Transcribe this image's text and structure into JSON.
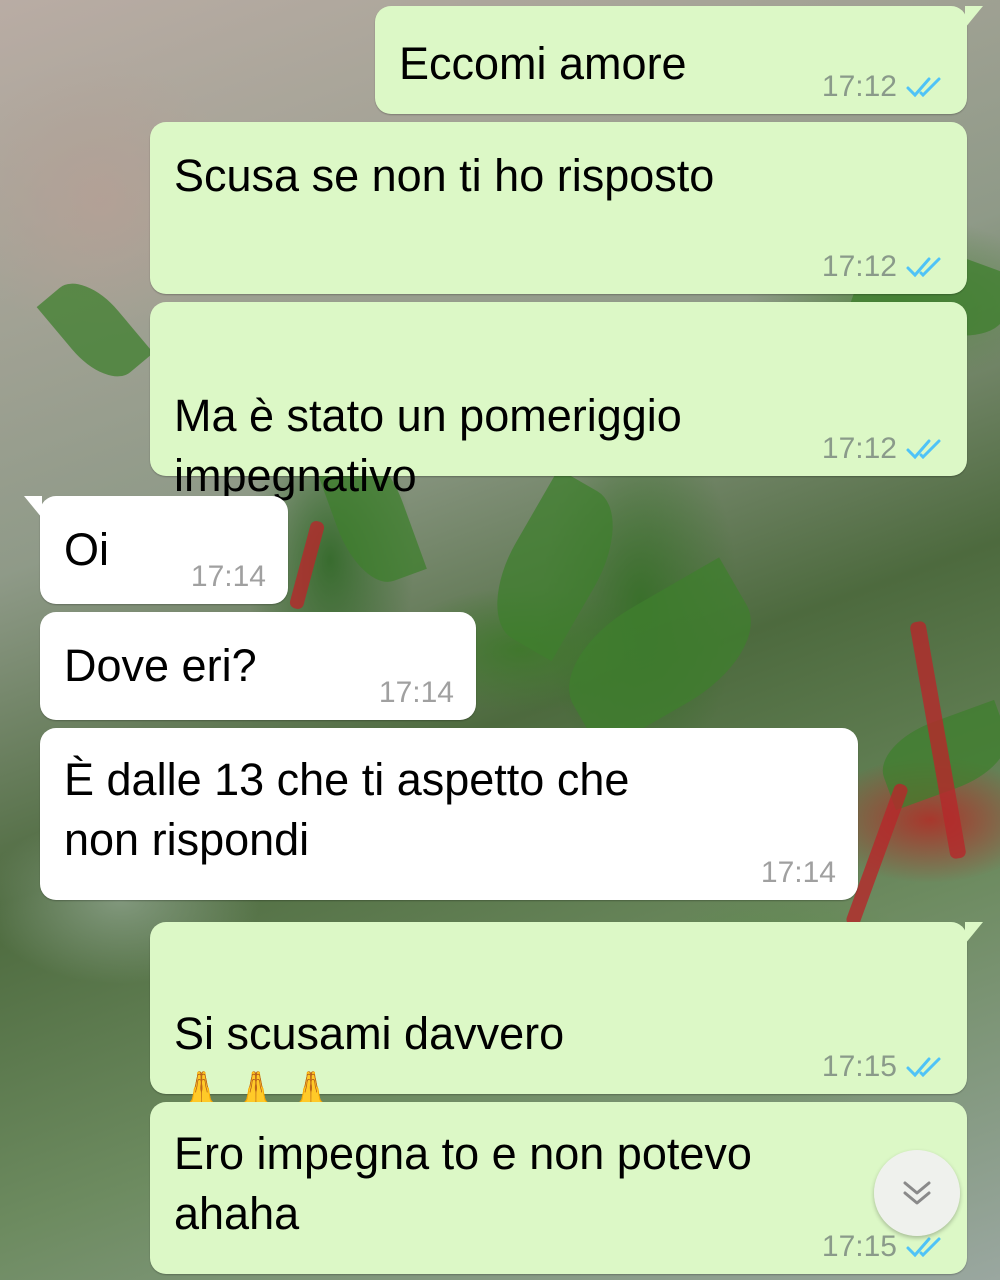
{
  "messages": [
    {
      "direction": "out",
      "text": "Eccomi amore",
      "time": "17:12",
      "status": "read"
    },
    {
      "direction": "out",
      "text": "Scusa se non ti ho risposto",
      "time": "17:12",
      "status": "read"
    },
    {
      "direction": "out",
      "text": "Ma è stato un pomeriggio\nimpegnativo",
      "emoji": "🤣🤣",
      "time": "17:12",
      "status": "read"
    },
    {
      "direction": "in",
      "text": "Oi",
      "time": "17:14"
    },
    {
      "direction": "in",
      "text": "Dove eri?",
      "time": "17:14"
    },
    {
      "direction": "in",
      "text": "È dalle 13 che ti aspetto che\nnon rispondi",
      "time": "17:14"
    },
    {
      "direction": "out",
      "text": "Si scusami davvero",
      "emoji": "🙏🙏🙏",
      "time": "17:15",
      "status": "read"
    },
    {
      "direction": "out",
      "text": "Ero impegna to e non potevo\nahaha",
      "time": "17:15",
      "status": "read"
    }
  ],
  "icons": {
    "read_receipt": "double-check-icon",
    "scroll_down": "chevron-down-icon"
  },
  "colors": {
    "outgoing_bubble": "#dcf8c6",
    "incoming_bubble": "#ffffff",
    "read_ticks": "#4fc3f7",
    "timestamp": "#8a9a8a"
  }
}
